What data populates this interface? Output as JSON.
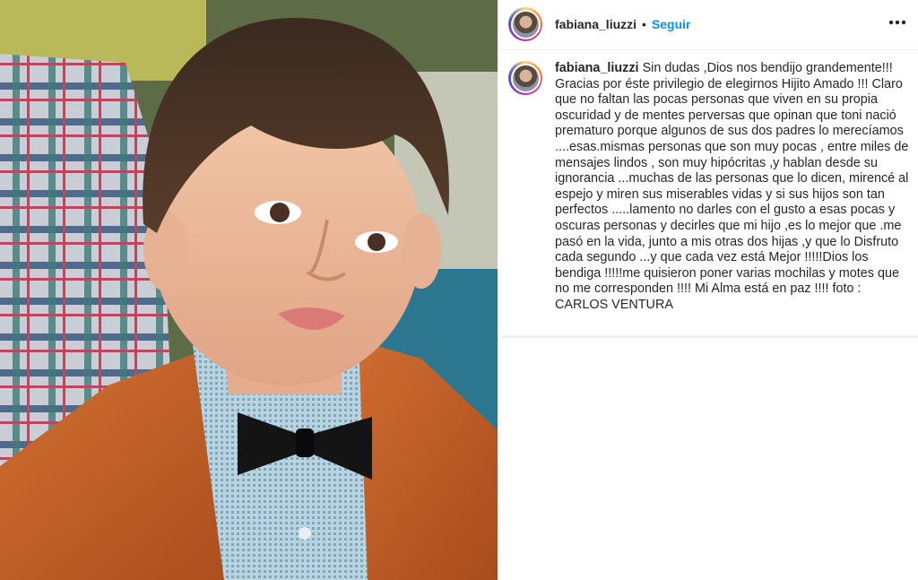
{
  "post": {
    "username": "fabiana_liuzzi",
    "separator": "•",
    "follow_label": "Seguir",
    "more_icon": "more-horizontal-icon"
  },
  "caption": {
    "username": "fabiana_liuzzi",
    "text": "Sin dudas ,Dios nos bendijo grandemente!!! Gracias por éste privilegio de elegirnos Hijito Amado !!! Claro que no faltan las pocas personas que viven en su propia oscuridad y de mentes perversas que opinan que toni nació prematuro porque algunos de sus dos padres lo merecíamos ....esas.mismas personas que son muy pocas , entre miles de mensajes lindos , son muy hipócritas ,y hablan desde su ignorancia ...muchas de las personas que lo dicen, mirencé al espejo y miren sus miserables vidas y si sus hijos son tan perfectos .....lamento no darles con el gusto a esas pocas y oscuras personas y decirles que mi hijo ,es lo mejor que .me pasó en la vida, junto a mis otras dos hijas ,y que lo Disfruto cada segundo ...y que cada vez está Mejor !!!!!Dios los bendiga !!!!!me quisieron poner varias mochilas y motes que no me corresponden !!!! Mi Alma está en paz !!!! foto : CARLOS VENTURA"
  },
  "colors": {
    "follow": "#0095f6",
    "text": "#262626",
    "divider": "#efefef"
  }
}
